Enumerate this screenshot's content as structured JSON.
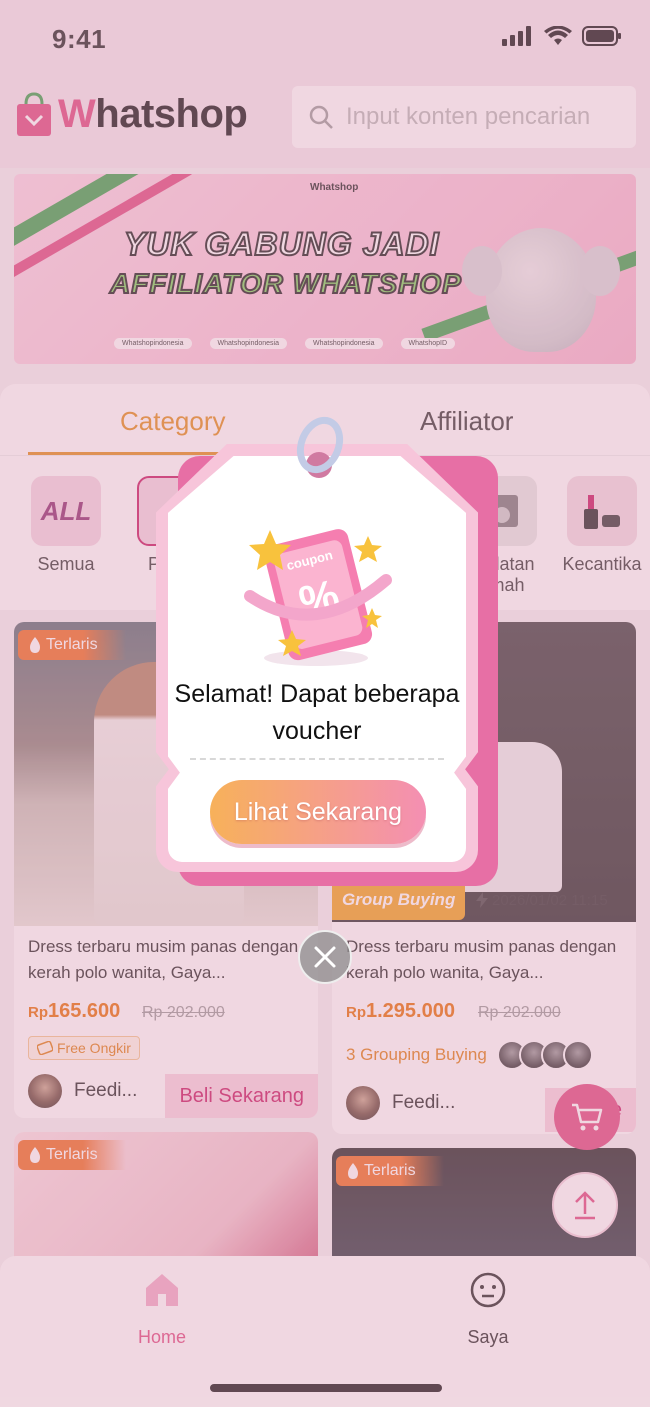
{
  "status_bar": {
    "time": "9:41"
  },
  "header": {
    "logo_prefix": "W",
    "logo_rest": "hatshop",
    "search_placeholder": "Input konten pencarian"
  },
  "banner": {
    "brand": "Whatshop",
    "line1": "YUK GABUNG JADI",
    "line2": "AFFILIATOR WHATSHOP",
    "socials": [
      "Whatshopindonesia",
      "Whatshopindonesia",
      "Whatshopindonesia",
      "WhatshopID"
    ]
  },
  "tabs": [
    {
      "label": "Category",
      "active": true
    },
    {
      "label": "Affiliator",
      "active": false
    }
  ],
  "categories": [
    {
      "icon": "ALL",
      "label": "Semua"
    },
    {
      "label": "Pak S"
    },
    {
      "label": "eralatan umah"
    },
    {
      "label": "Kecantika"
    }
  ],
  "products": [
    {
      "tag": "Terlaris",
      "title": "Dress terbaru musim panas dengan kerah polo wanita, Gaya...",
      "currency": "Rp",
      "price": "165.600",
      "old_price": "Rp 202.000",
      "shipping": "Free Ongkir",
      "seller": "Feedi...",
      "buy_label": "Beli Sekarang"
    },
    {
      "group_tag": "Group Buying",
      "group_time": "2026/01/02 11:15",
      "title": "Dress terbaru musim panas dengan kerah polo wanita, Gaya...",
      "currency": "Rp",
      "price": "1.295.000",
      "old_price": "Rp 202.000",
      "grouping": "3 Grouping Buying",
      "seller": "Feedi...",
      "buy_label": "Beli Se"
    },
    {
      "tag": "Terlaris"
    },
    {
      "tag": "Terlaris"
    }
  ],
  "popup": {
    "coupon_word": "coupon",
    "coupon_symbol": "%",
    "message": "Selamat! Dapat beberapa voucher",
    "cta": "Lihat Sekarang"
  },
  "bottom_nav": [
    {
      "label": "Home",
      "active": true,
      "icon": "home-icon"
    },
    {
      "label": "Saya",
      "active": false,
      "icon": "face-icon"
    }
  ],
  "colors": {
    "brand_pink": "#e0457f",
    "accent_orange": "#e38a15",
    "price_orange": "#e86c00"
  }
}
